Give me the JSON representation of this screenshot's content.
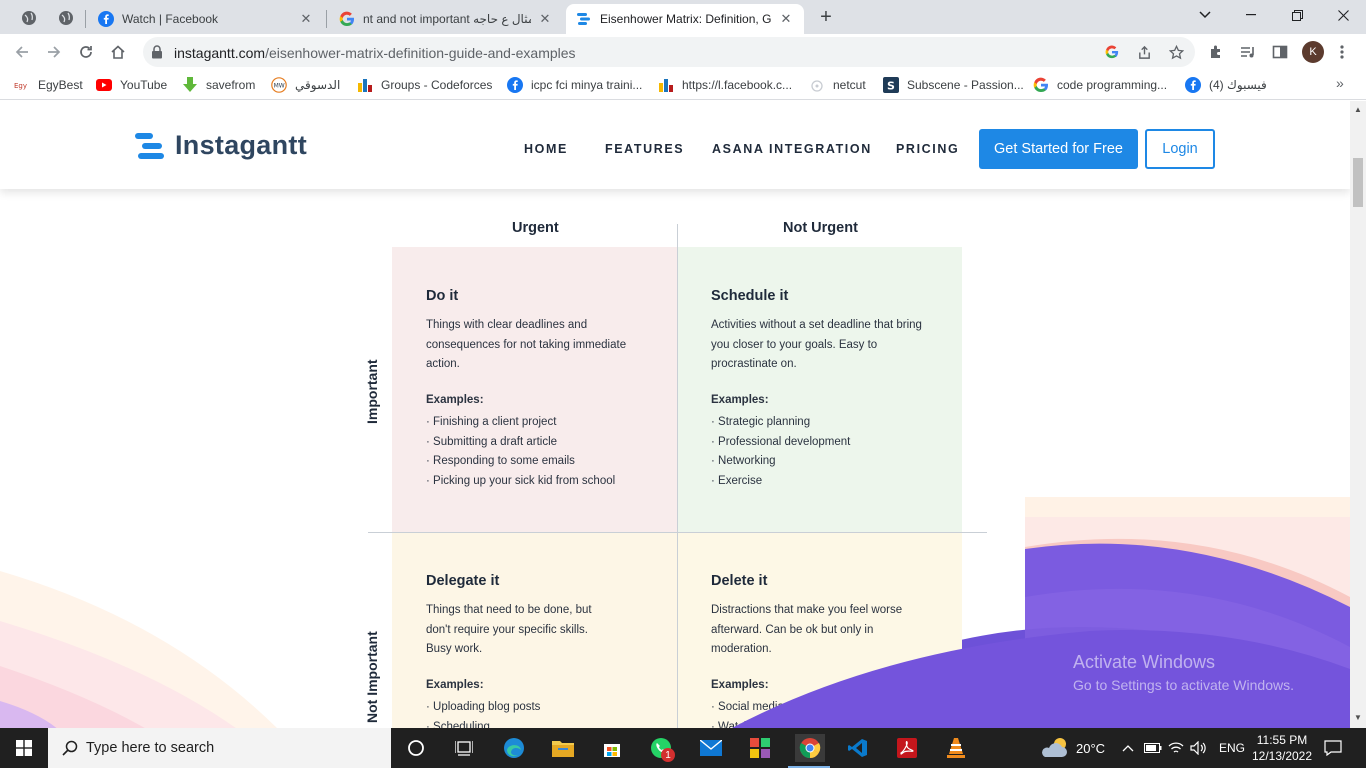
{
  "browser": {
    "tabs": [
      {
        "title": "Watch | Facebook",
        "icon": "facebook-icon"
      },
      {
        "title": "‫مثال ع حاجه nt and not important‬",
        "icon": "google-icon"
      },
      {
        "title": "Eisenhower Matrix: Definition, Gu",
        "icon": "instagantt-icon",
        "active": true
      }
    ],
    "url_host": "instagantt.com",
    "url_path": "/eisenhower-matrix-definition-guide-and-examples",
    "profile_initial": "K",
    "bookmarks": [
      {
        "label": "EgyBest",
        "icon": "egybest-icon"
      },
      {
        "label": "YouTube",
        "icon": "youtube-icon"
      },
      {
        "label": "savefrom",
        "icon": "download-arrow-icon"
      },
      {
        "label": "الدسوقي",
        "icon": "mw-icon"
      },
      {
        "label": "Groups - Codeforces",
        "icon": "codeforces-icon"
      },
      {
        "label": "icpc fci minya traini...",
        "icon": "facebook-icon"
      },
      {
        "label": "https://l.facebook.c...",
        "icon": "codeforces-icon"
      },
      {
        "label": "netcut",
        "icon": "netcut-icon"
      },
      {
        "label": "Subscene - Passion...",
        "icon": "subscene-icon"
      },
      {
        "label": "code programming...",
        "icon": "google-icon"
      },
      {
        "label": "(4) فيسبوك",
        "icon": "facebook-icon"
      }
    ]
  },
  "site": {
    "brand": "Instagantt",
    "nav": [
      "HOME",
      "FEATURES",
      "ASANA INTEGRATION",
      "PRICING"
    ],
    "cta_label": "Get Started for Free",
    "login_label": "Login",
    "accent": "#1e88e5"
  },
  "matrix": {
    "col_urgent": "Urgent",
    "col_not_urgent": "Not Urgent",
    "row_important": "Important",
    "row_not_important": "Not Important",
    "examples_label": "Examples:",
    "quadrants": {
      "do": {
        "title": "Do it",
        "desc": "Things with clear deadlines and consequences for not taking immediate action.",
        "examples": [
          "· Finishing a client project",
          "· Submitting a draft article",
          "· Responding to some emails",
          "· Picking up your sick kid from school"
        ],
        "color": "#f8ecec"
      },
      "schedule": {
        "title": "Schedule it",
        "desc": "Activities without a set deadline that bring you closer to your goals. Easy to procrastinate on.",
        "examples": [
          "· Strategic planning",
          "· Professional development",
          "· Networking",
          "· Exercise"
        ],
        "color": "#edf6ec"
      },
      "delegate": {
        "title": "Delegate it",
        "desc": "Things that need to be done, but don't require your specific skills. Busy work.",
        "examples": [
          "· Uploading blog posts",
          "· Scheduling"
        ],
        "color": "#fdf6e6"
      },
      "delete": {
        "title": "Delete it",
        "desc": "Distractions that make you feel worse afterward. Can be ok but only in moderation.",
        "examples": [
          "· Social media",
          "· Watchi"
        ],
        "color": "#fdf8e6"
      }
    }
  },
  "watermark": {
    "title": "Activate Windows",
    "subtitle": "Go to Settings to activate Windows."
  },
  "taskbar": {
    "search_placeholder": "Type here to search",
    "weather": "20°C",
    "language": "ENG",
    "time": "11:55 PM",
    "date": "12/13/2022",
    "whatsapp_badge": "1"
  }
}
